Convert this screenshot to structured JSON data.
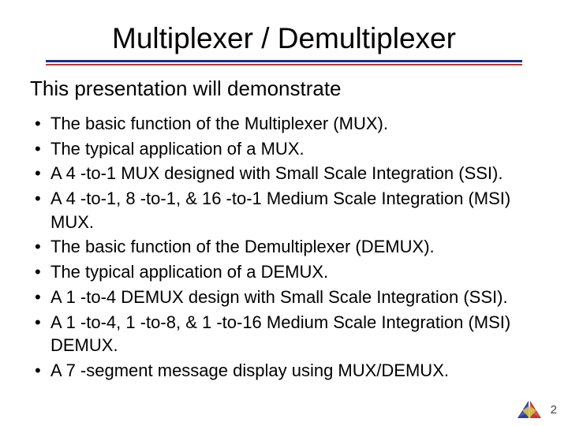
{
  "title": "Multiplexer / Demultiplexer",
  "intro": "This presentation will demonstrate",
  "bullets": [
    "The basic function of the Multiplexer (MUX).",
    "The typical application of a MUX.",
    "A 4 -to-1 MUX designed with Small Scale Integration (SSI).",
    "A 4 -to-1, 8 -to-1, & 16 -to-1 Medium Scale Integration (MSI) MUX.",
    "The basic function of the Demultiplexer (DEMUX).",
    "The typical application of a DEMUX.",
    "A 1 -to-4 DEMUX design with Small Scale Integration (SSI).",
    "A 1 -to-4, 1 -to-8, & 1 -to-16 Medium Scale Integration (MSI) DEMUX.",
    "A 7 -segment message display using MUX/DEMUX."
  ],
  "page_number": "2",
  "colors": {
    "rule_top": "#1c2f86",
    "rule_bottom": "#c0382e"
  }
}
